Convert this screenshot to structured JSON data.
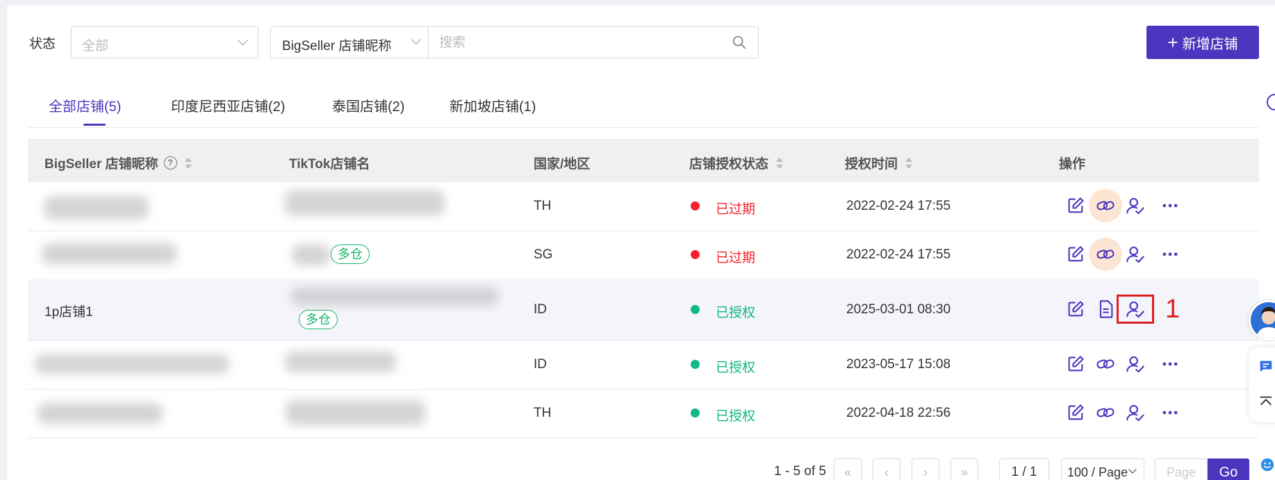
{
  "filters": {
    "status_label": "状态",
    "status_value": "全部",
    "search_type": "BigSeller 店铺昵称",
    "search_placeholder": "搜索"
  },
  "add_button": {
    "plus": "+",
    "label": "新增店铺"
  },
  "tabs": [
    {
      "label": "全部店铺(5)",
      "active": true
    },
    {
      "label": "印度尼西亚店铺(2)",
      "active": false
    },
    {
      "label": "泰国店铺(2)",
      "active": false
    },
    {
      "label": "新加坡店铺(1)",
      "active": false
    }
  ],
  "table": {
    "headers": {
      "nickname": "BigSeller 店铺昵称",
      "help": "?",
      "tiktok_name": "TikTok店铺名",
      "country": "国家/地区",
      "auth_status": "店铺授权状态",
      "auth_time": "授权时间",
      "actions": "操作"
    },
    "rows": [
      {
        "nickname": "",
        "tiktok_name": "",
        "badge": "",
        "country": "TH",
        "status": "已过期",
        "status_color": "#f5222d",
        "time": "2022-02-24 17:55"
      },
      {
        "nickname": "",
        "tiktok_name": "",
        "badge": "多仓",
        "country": "SG",
        "status": "已过期",
        "status_color": "#f5222d",
        "time": "2022-02-24 17:55"
      },
      {
        "nickname": "1p店铺1",
        "tiktok_name": "",
        "badge": "多仓",
        "country": "ID",
        "status": "已授权",
        "status_color": "#12b886",
        "time": "2025-03-01 08:30"
      },
      {
        "nickname": "",
        "tiktok_name": "",
        "badge": "",
        "country": "ID",
        "status": "已授权",
        "status_color": "#12b886",
        "time": "2023-05-17 15:08"
      },
      {
        "nickname": "",
        "tiktok_name": "",
        "badge": "",
        "country": "TH",
        "status": "已授权",
        "status_color": "#12b886",
        "time": "2022-04-18 22:56"
      }
    ]
  },
  "annotation": {
    "number": "1"
  },
  "pagination": {
    "total": "1 - 5 of 5",
    "first": "«",
    "prev": "‹",
    "next": "›",
    "last": "»",
    "current": "1 / 1",
    "page_size": "100 / Page",
    "page_placeholder": "Page",
    "go": "Go"
  },
  "colors": {
    "primary": "#4b36bf",
    "expired": "#f5222d",
    "authorized": "#12b886",
    "annotation": "#e02020"
  },
  "icons": [
    "search-icon",
    "chevron-down-icon",
    "edit-icon",
    "link-icon",
    "document-icon",
    "user-check-icon",
    "more-icon",
    "help-icon"
  ]
}
